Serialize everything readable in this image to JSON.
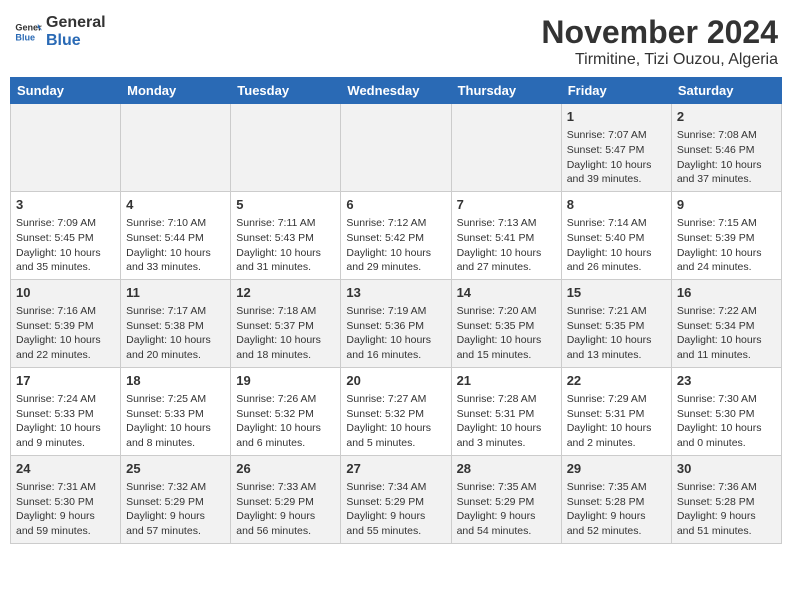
{
  "header": {
    "logo_line1": "General",
    "logo_line2": "Blue",
    "month": "November 2024",
    "location": "Tirmitine, Tizi Ouzou, Algeria"
  },
  "weekdays": [
    "Sunday",
    "Monday",
    "Tuesday",
    "Wednesday",
    "Thursday",
    "Friday",
    "Saturday"
  ],
  "weeks": [
    [
      {
        "day": "",
        "info": ""
      },
      {
        "day": "",
        "info": ""
      },
      {
        "day": "",
        "info": ""
      },
      {
        "day": "",
        "info": ""
      },
      {
        "day": "",
        "info": ""
      },
      {
        "day": "1",
        "info": "Sunrise: 7:07 AM\nSunset: 5:47 PM\nDaylight: 10 hours and 39 minutes."
      },
      {
        "day": "2",
        "info": "Sunrise: 7:08 AM\nSunset: 5:46 PM\nDaylight: 10 hours and 37 minutes."
      }
    ],
    [
      {
        "day": "3",
        "info": "Sunrise: 7:09 AM\nSunset: 5:45 PM\nDaylight: 10 hours and 35 minutes."
      },
      {
        "day": "4",
        "info": "Sunrise: 7:10 AM\nSunset: 5:44 PM\nDaylight: 10 hours and 33 minutes."
      },
      {
        "day": "5",
        "info": "Sunrise: 7:11 AM\nSunset: 5:43 PM\nDaylight: 10 hours and 31 minutes."
      },
      {
        "day": "6",
        "info": "Sunrise: 7:12 AM\nSunset: 5:42 PM\nDaylight: 10 hours and 29 minutes."
      },
      {
        "day": "7",
        "info": "Sunrise: 7:13 AM\nSunset: 5:41 PM\nDaylight: 10 hours and 27 minutes."
      },
      {
        "day": "8",
        "info": "Sunrise: 7:14 AM\nSunset: 5:40 PM\nDaylight: 10 hours and 26 minutes."
      },
      {
        "day": "9",
        "info": "Sunrise: 7:15 AM\nSunset: 5:39 PM\nDaylight: 10 hours and 24 minutes."
      }
    ],
    [
      {
        "day": "10",
        "info": "Sunrise: 7:16 AM\nSunset: 5:39 PM\nDaylight: 10 hours and 22 minutes."
      },
      {
        "day": "11",
        "info": "Sunrise: 7:17 AM\nSunset: 5:38 PM\nDaylight: 10 hours and 20 minutes."
      },
      {
        "day": "12",
        "info": "Sunrise: 7:18 AM\nSunset: 5:37 PM\nDaylight: 10 hours and 18 minutes."
      },
      {
        "day": "13",
        "info": "Sunrise: 7:19 AM\nSunset: 5:36 PM\nDaylight: 10 hours and 16 minutes."
      },
      {
        "day": "14",
        "info": "Sunrise: 7:20 AM\nSunset: 5:35 PM\nDaylight: 10 hours and 15 minutes."
      },
      {
        "day": "15",
        "info": "Sunrise: 7:21 AM\nSunset: 5:35 PM\nDaylight: 10 hours and 13 minutes."
      },
      {
        "day": "16",
        "info": "Sunrise: 7:22 AM\nSunset: 5:34 PM\nDaylight: 10 hours and 11 minutes."
      }
    ],
    [
      {
        "day": "17",
        "info": "Sunrise: 7:24 AM\nSunset: 5:33 PM\nDaylight: 10 hours and 9 minutes."
      },
      {
        "day": "18",
        "info": "Sunrise: 7:25 AM\nSunset: 5:33 PM\nDaylight: 10 hours and 8 minutes."
      },
      {
        "day": "19",
        "info": "Sunrise: 7:26 AM\nSunset: 5:32 PM\nDaylight: 10 hours and 6 minutes."
      },
      {
        "day": "20",
        "info": "Sunrise: 7:27 AM\nSunset: 5:32 PM\nDaylight: 10 hours and 5 minutes."
      },
      {
        "day": "21",
        "info": "Sunrise: 7:28 AM\nSunset: 5:31 PM\nDaylight: 10 hours and 3 minutes."
      },
      {
        "day": "22",
        "info": "Sunrise: 7:29 AM\nSunset: 5:31 PM\nDaylight: 10 hours and 2 minutes."
      },
      {
        "day": "23",
        "info": "Sunrise: 7:30 AM\nSunset: 5:30 PM\nDaylight: 10 hours and 0 minutes."
      }
    ],
    [
      {
        "day": "24",
        "info": "Sunrise: 7:31 AM\nSunset: 5:30 PM\nDaylight: 9 hours and 59 minutes."
      },
      {
        "day": "25",
        "info": "Sunrise: 7:32 AM\nSunset: 5:29 PM\nDaylight: 9 hours and 57 minutes."
      },
      {
        "day": "26",
        "info": "Sunrise: 7:33 AM\nSunset: 5:29 PM\nDaylight: 9 hours and 56 minutes."
      },
      {
        "day": "27",
        "info": "Sunrise: 7:34 AM\nSunset: 5:29 PM\nDaylight: 9 hours and 55 minutes."
      },
      {
        "day": "28",
        "info": "Sunrise: 7:35 AM\nSunset: 5:29 PM\nDaylight: 9 hours and 54 minutes."
      },
      {
        "day": "29",
        "info": "Sunrise: 7:35 AM\nSunset: 5:28 PM\nDaylight: 9 hours and 52 minutes."
      },
      {
        "day": "30",
        "info": "Sunrise: 7:36 AM\nSunset: 5:28 PM\nDaylight: 9 hours and 51 minutes."
      }
    ]
  ]
}
